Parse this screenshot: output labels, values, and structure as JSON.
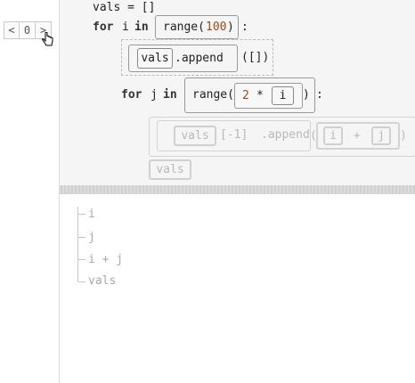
{
  "pager": {
    "prev": "<",
    "index": "0",
    "next": ">"
  },
  "code": {
    "line1": "vals = []",
    "for1_kw": "for",
    "for1_var": "i",
    "for1_in": "in",
    "range1": "range(",
    "range1_arg": "100",
    "range1_close": ")",
    "colon": ":",
    "append_target": "vals",
    "append_method": ".append",
    "append_args": "([])",
    "for2_kw": "for",
    "for2_var": "j",
    "for2_in": "in",
    "range2": "range(",
    "range2_num": "2",
    "range2_op": "*",
    "range2_var": "i",
    "range2_close": ")",
    "append2_target": "vals",
    "append2_index": "[-1]",
    "append2_method": ".append",
    "append2_open": "(",
    "append2_left": "i",
    "append2_op": "+",
    "append2_right": "j",
    "append2_close": ")",
    "ghost_vals": "vals"
  },
  "tree": {
    "items": [
      "i",
      "j",
      "i + j",
      "vals"
    ]
  }
}
